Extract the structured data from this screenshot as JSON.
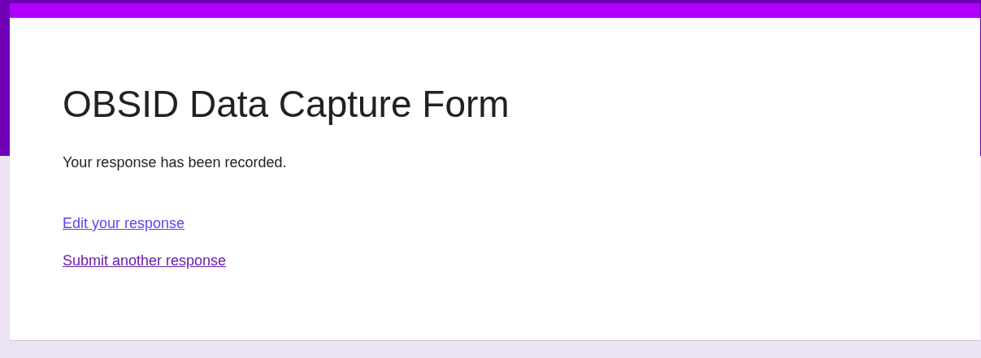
{
  "form": {
    "title": "OBSID Data Capture Form",
    "message": "Your response has been recorded.",
    "links": [
      {
        "label": "Edit your response",
        "visited": false
      },
      {
        "label": "Submit another response",
        "visited": true
      }
    ]
  }
}
